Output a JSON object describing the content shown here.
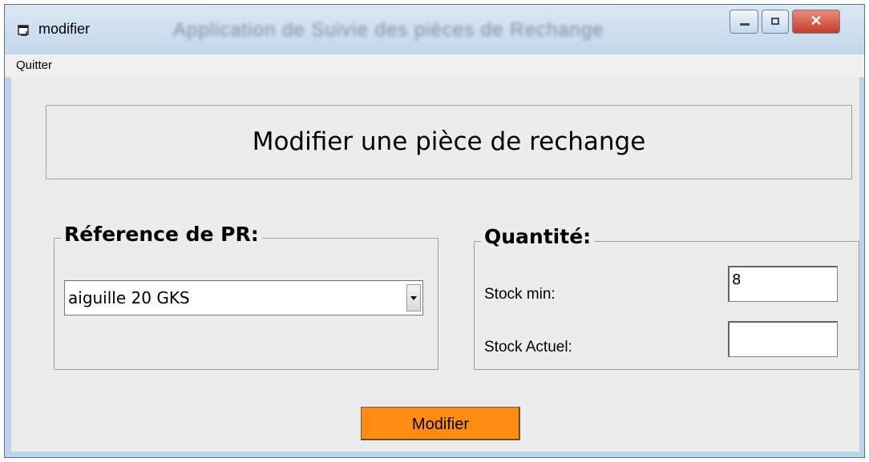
{
  "window": {
    "title": "modifier",
    "background_title": "Application de Suivie des pièces de Rechange"
  },
  "menu": {
    "quit_label": "Quitter"
  },
  "form": {
    "header": "Modifier une pièce de rechange",
    "reference_group": {
      "title": "Réference de PR:",
      "selected_value": "aiguille 20 GKS"
    },
    "quantity_group": {
      "title": "Quantité:",
      "stock_min_label": "Stock min:",
      "stock_min_value": "8",
      "stock_actual_label": "Stock Actuel:",
      "stock_actual_value": ""
    },
    "submit_label": "Modifier"
  },
  "colors": {
    "button_bg": "#ff8c12",
    "client_bg": "#ececec",
    "frame_bg": "#bcd3ea"
  },
  "icons": {
    "app_icon": "window-icon",
    "minimize": "minimize-icon",
    "maximize": "maximize-icon",
    "close": "close-icon",
    "dropdown": "chevron-down-icon"
  }
}
